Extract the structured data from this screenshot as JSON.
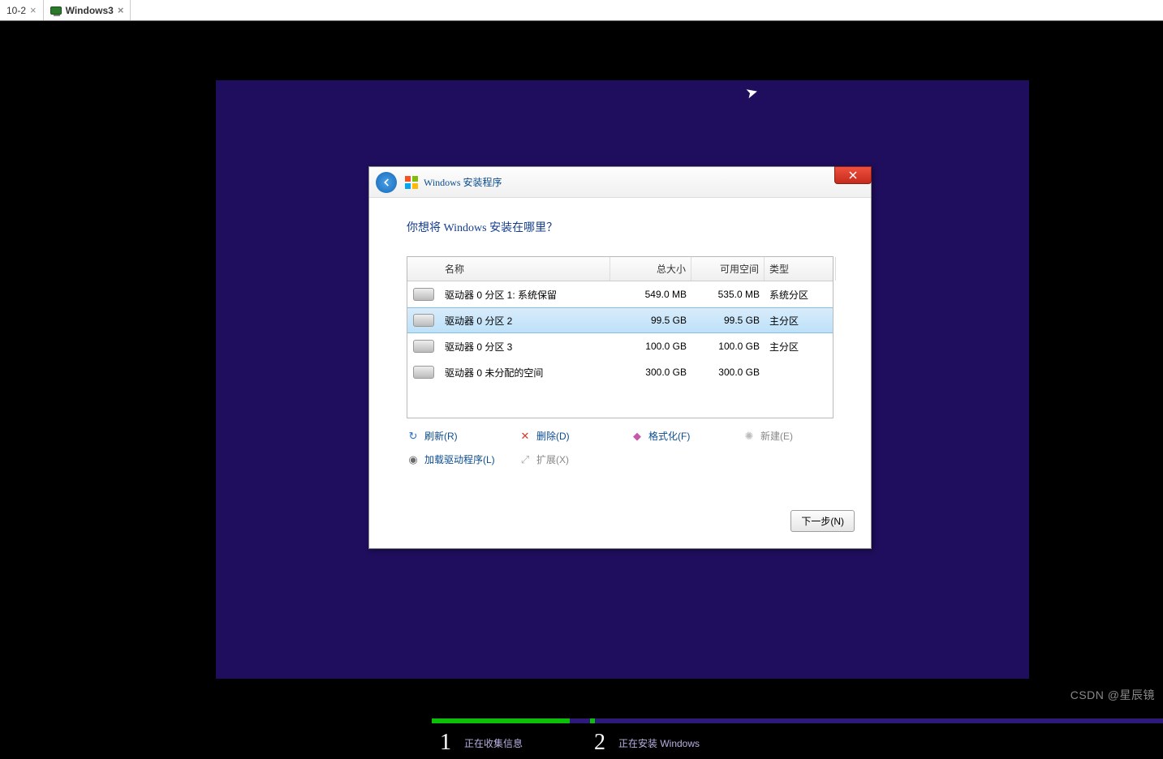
{
  "vm_tabs": {
    "tab0_label": "10-2",
    "tab1_label": "Windows3"
  },
  "dialog": {
    "title": "Windows 安装程序",
    "heading": "你想将 Windows 安装在哪里？",
    "next_label": "下一步(N)"
  },
  "columns": {
    "name": "名称",
    "total": "总大小",
    "free": "可用空间",
    "type": "类型"
  },
  "partitions": [
    {
      "name": "驱动器 0 分区 1: 系统保留",
      "total": "549.0 MB",
      "free": "535.0 MB",
      "type": "系统分区",
      "selected": false
    },
    {
      "name": "驱动器 0 分区 2",
      "total": "99.5 GB",
      "free": "99.5 GB",
      "type": "主分区",
      "selected": true
    },
    {
      "name": "驱动器 0 分区 3",
      "total": "100.0 GB",
      "free": "100.0 GB",
      "type": "主分区",
      "selected": false
    },
    {
      "name": "驱动器 0 未分配的空间",
      "total": "300.0 GB",
      "free": "300.0 GB",
      "type": "",
      "selected": false
    }
  ],
  "tools": {
    "refresh": "刷新(R)",
    "delete": "删除(D)",
    "format": "格式化(F)",
    "new": "新建(E)",
    "load_driver": "加载驱动程序(L)",
    "extend": "扩展(X)"
  },
  "progress": {
    "step1": "正在收集信息",
    "step2": "正在安装 Windows"
  },
  "watermark": "CSDN @星辰镜"
}
